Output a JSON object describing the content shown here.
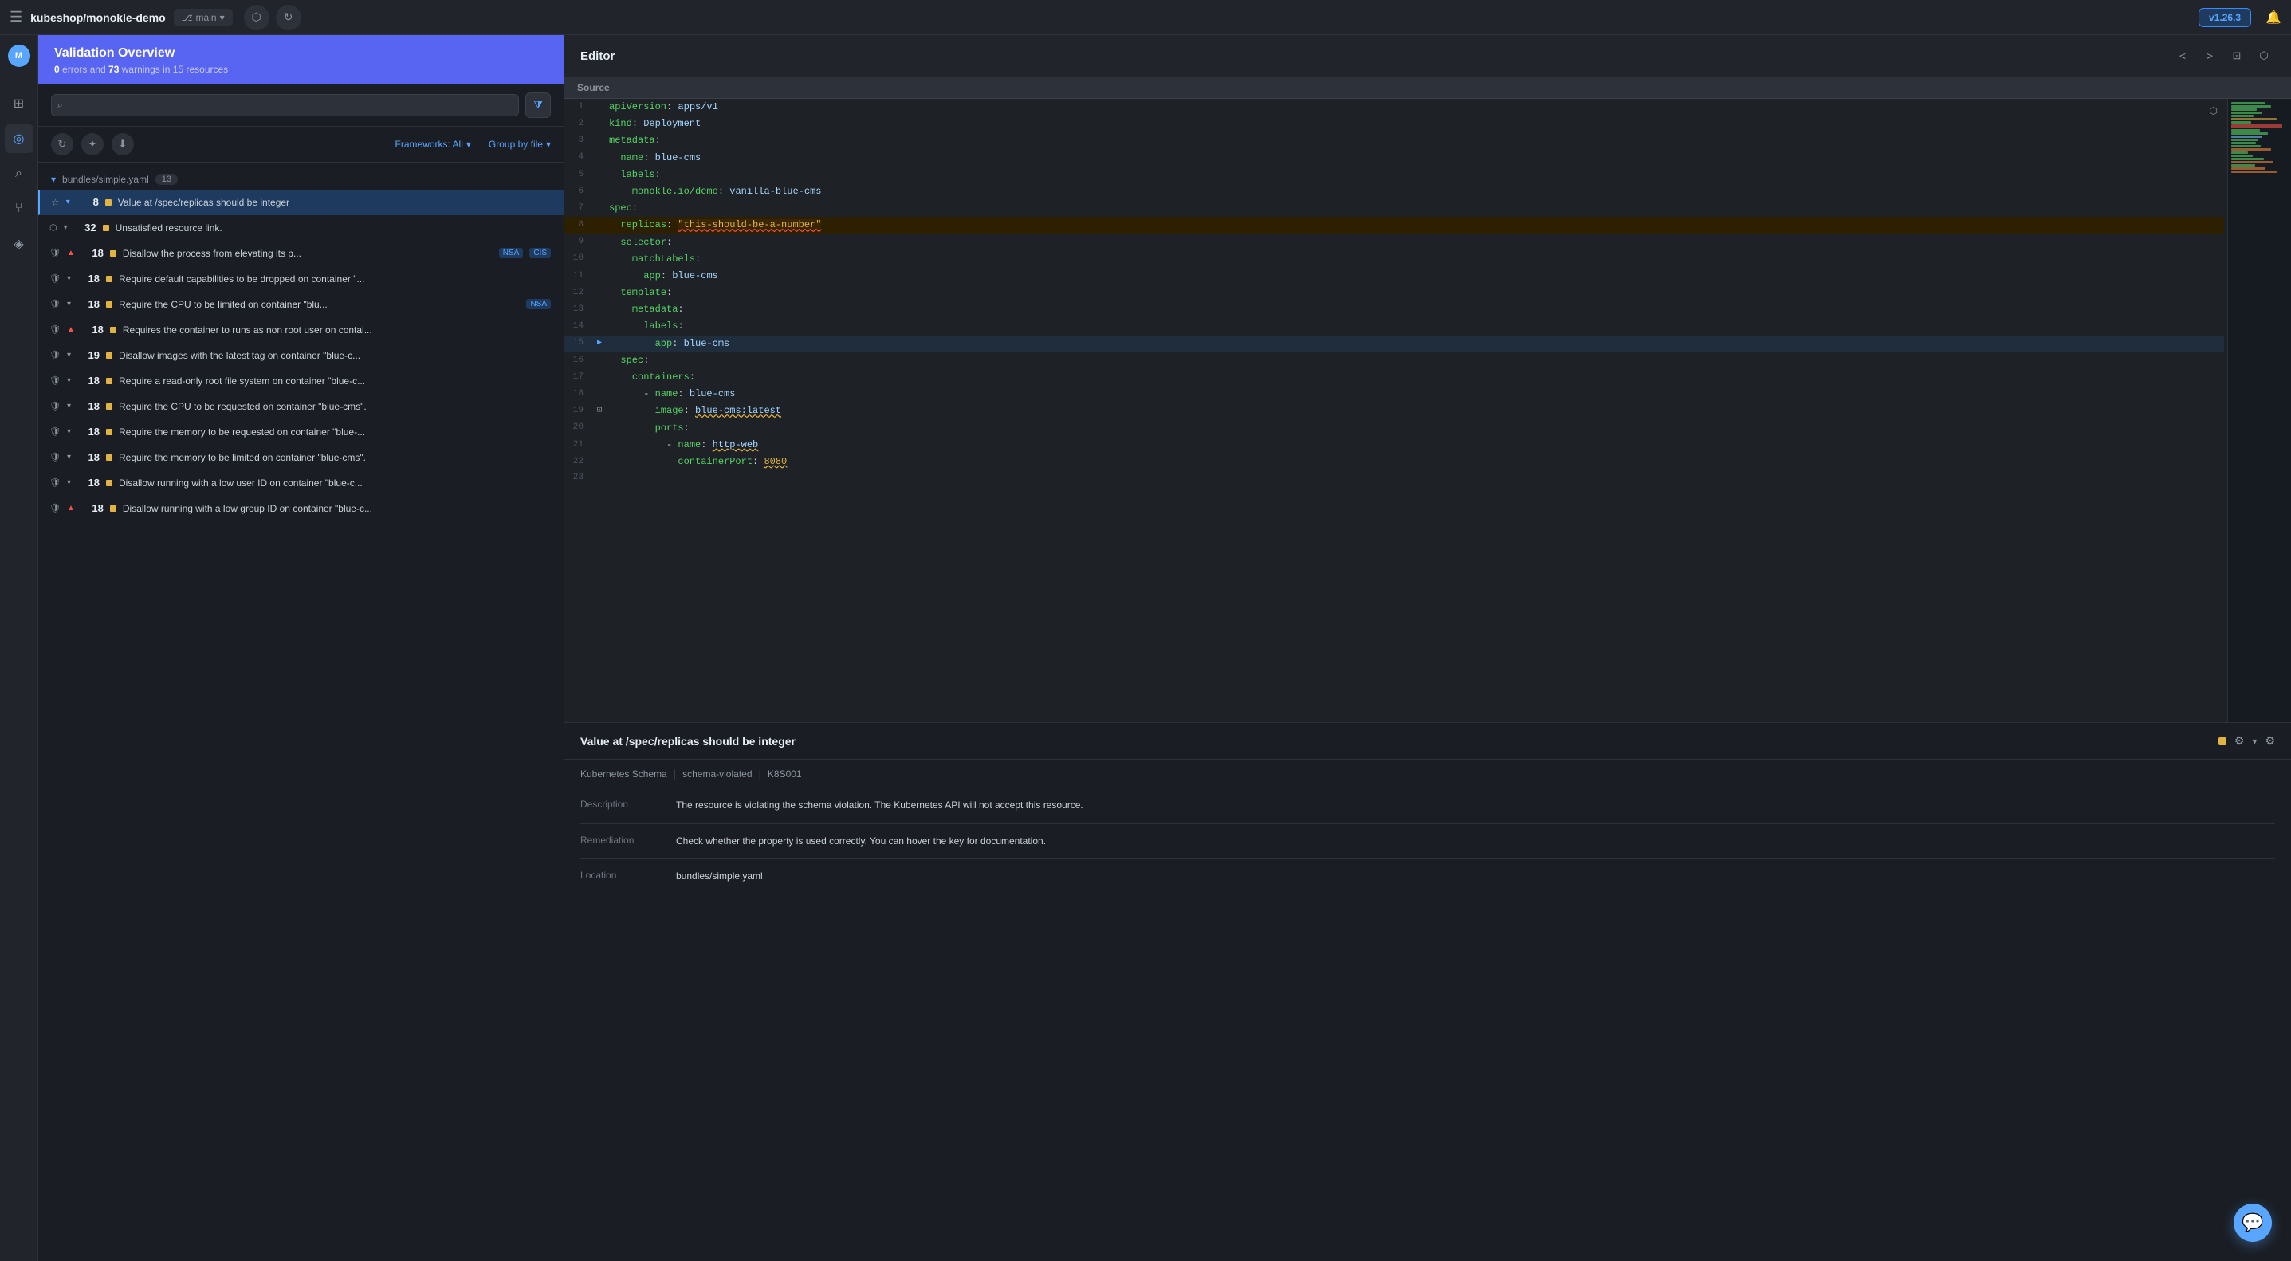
{
  "topbar": {
    "hamburger": "☰",
    "repo": "kubeshop/monokle-demo",
    "branch_icon": "⎇",
    "branch": "main",
    "branch_chevron": "▾",
    "share_icon": "⬡",
    "refresh_icon": "↻",
    "version": "v1.26.3",
    "bell_icon": "🔔"
  },
  "sidebar": {
    "icons": [
      {
        "name": "files-icon",
        "glyph": "⊞",
        "active": false
      },
      {
        "name": "validation-icon",
        "glyph": "◎",
        "active": true
      },
      {
        "name": "search-icon",
        "glyph": "⌕",
        "active": false
      },
      {
        "name": "git-icon",
        "glyph": "⑂",
        "active": false
      },
      {
        "name": "tag-icon",
        "glyph": "◈",
        "active": false
      }
    ]
  },
  "validation": {
    "title": "Validation Overview",
    "errors_count": "0",
    "errors_label": "errors",
    "and_label": "and",
    "warnings_count": "73",
    "warnings_label": "warnings",
    "in_label": "in",
    "resources_count": "15",
    "resources_label": "resources",
    "search_placeholder": "",
    "frameworks_label": "Frameworks: All",
    "group_by_label": "Group by file",
    "file_group": "bundles/simple.yaml",
    "file_count": "13",
    "items": [
      {
        "count": "8",
        "severity": "warning",
        "text": "Value at /spec/replicas should be integer",
        "tags": [],
        "selected": true,
        "icon": "star",
        "expand": true
      },
      {
        "count": "32",
        "severity": "warning",
        "text": "Unsatisfied resource link.",
        "tags": [],
        "selected": false,
        "icon": "link",
        "expand": true
      },
      {
        "count": "18",
        "severity": "warning",
        "text": "Disallow the process from elevating its p...",
        "tags": [
          "NSA",
          "CIS"
        ],
        "selected": false,
        "icon": "shield",
        "expand": false,
        "arrow_up": true
      },
      {
        "count": "18",
        "severity": "warning",
        "text": "Require default capabilities to be dropped on container \"...",
        "tags": [],
        "selected": false,
        "icon": "shield",
        "expand": true
      },
      {
        "count": "18",
        "severity": "warning",
        "text": "Require the CPU to be limited on container \"blu...",
        "tags": [
          "NSA"
        ],
        "selected": false,
        "icon": "shield",
        "expand": true
      },
      {
        "count": "18",
        "severity": "warning",
        "text": "Requires the container to runs as non root user on contai...",
        "tags": [],
        "selected": false,
        "icon": "shield",
        "expand": false,
        "arrow_up": true
      },
      {
        "count": "19",
        "severity": "warning",
        "text": "Disallow images with the latest tag on container \"blue-c...",
        "tags": [],
        "selected": false,
        "icon": "shield",
        "expand": true
      },
      {
        "count": "18",
        "severity": "warning",
        "text": "Require a read-only root file system on container \"blue-c...",
        "tags": [],
        "selected": false,
        "icon": "shield",
        "expand": true
      },
      {
        "count": "18",
        "severity": "warning",
        "text": "Require the CPU to be requested on container \"blue-cms\".",
        "tags": [],
        "selected": false,
        "icon": "shield",
        "expand": true
      },
      {
        "count": "18",
        "severity": "warning",
        "text": "Require the memory to be requested on container \"blue-...",
        "tags": [],
        "selected": false,
        "icon": "shield",
        "expand": true
      },
      {
        "count": "18",
        "severity": "warning",
        "text": "Require the memory to be limited on container \"blue-cms\".",
        "tags": [],
        "selected": false,
        "icon": "shield",
        "expand": true
      },
      {
        "count": "18",
        "severity": "warning",
        "text": "Disallow running with a low user ID on container \"blue-c...",
        "tags": [],
        "selected": false,
        "icon": "shield",
        "expand": true
      },
      {
        "count": "18",
        "severity": "warning",
        "text": "Disallow running with a low group ID on container \"blue-c...",
        "tags": [],
        "selected": false,
        "icon": "shield",
        "expand": false,
        "arrow_up": true
      }
    ]
  },
  "editor": {
    "title": "Editor",
    "source_label": "Source",
    "lines": [
      {
        "num": 1,
        "content": "apiVersion: apps/v1",
        "highlight": false,
        "arrow": false
      },
      {
        "num": 2,
        "content": "kind: Deployment",
        "highlight": false
      },
      {
        "num": 3,
        "content": "metadata:",
        "highlight": false
      },
      {
        "num": 4,
        "content": "  name: blue-cms",
        "highlight": false
      },
      {
        "num": 5,
        "content": "  labels:",
        "highlight": false
      },
      {
        "num": 6,
        "content": "    monokle.io/demo: vanilla-blue-cms",
        "highlight": false
      },
      {
        "num": 7,
        "content": "spec:",
        "highlight": false
      },
      {
        "num": 8,
        "content": "  replicas: \"this-should-be-a-number\"",
        "highlight": true
      },
      {
        "num": 9,
        "content": "  selector:",
        "highlight": false
      },
      {
        "num": 10,
        "content": "    matchLabels:",
        "highlight": false
      },
      {
        "num": 11,
        "content": "      app: blue-cms",
        "highlight": false
      },
      {
        "num": 12,
        "content": "  template:",
        "highlight": false
      },
      {
        "num": 13,
        "content": "    metadata:",
        "highlight": false
      },
      {
        "num": 14,
        "content": "      labels:",
        "highlight": false
      },
      {
        "num": 15,
        "content": "        app: blue-cms",
        "highlight": false,
        "arrow": true
      },
      {
        "num": 16,
        "content": "  spec:",
        "highlight": false
      },
      {
        "num": 17,
        "content": "    containers:",
        "highlight": false
      },
      {
        "num": 18,
        "content": "      - name: blue-cms",
        "highlight": false
      },
      {
        "num": 19,
        "content": "        image: blue-cms:latest",
        "highlight": false,
        "copy": true
      },
      {
        "num": 20,
        "content": "        ports:",
        "highlight": false
      },
      {
        "num": 21,
        "content": "          - name: http-web",
        "highlight": false
      },
      {
        "num": 22,
        "content": "            containerPort: 8080",
        "highlight": false
      },
      {
        "num": 23,
        "content": "",
        "highlight": false
      }
    ]
  },
  "issue_detail": {
    "title": "Value at /spec/replicas should be integer",
    "schema_name": "Kubernetes Schema",
    "rule_id": "schema-violated",
    "code": "K8S001",
    "description_label": "Description",
    "description": "The resource is violating the schema violation. The Kubernetes API will not accept this resource.",
    "remediation_label": "Remediation",
    "remediation": "Check whether the property is used correctly. You can hover the key for documentation.",
    "location_label": "Location",
    "location": "bundles/simple.yaml"
  }
}
